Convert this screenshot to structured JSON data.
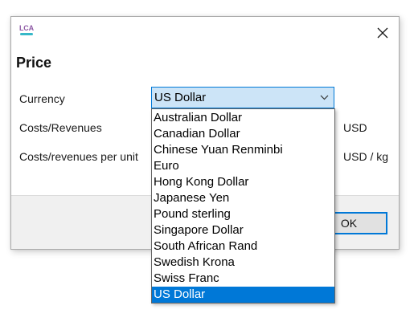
{
  "dialog": {
    "title": "Price",
    "app_icon": {
      "name": "lca-app-icon",
      "text": "LCA"
    },
    "close_icon": "close-icon"
  },
  "form": {
    "currency_label": "Currency",
    "costs_label": "Costs/Revenues",
    "costs_per_unit_label": "Costs/revenues per unit",
    "costs_unit": "USD",
    "costs_per_unit_unit": "USD / kg"
  },
  "currency_select": {
    "value": "US Dollar",
    "arrow_icon": "chevron-down-icon",
    "options": [
      "Australian Dollar",
      "Canadian Dollar",
      "Chinese Yuan Renminbi",
      "Euro",
      "Hong Kong Dollar",
      "Japanese Yen",
      "Pound sterling",
      "Singapore Dollar",
      "South African Rand",
      "Swedish Krona",
      "Swiss Franc",
      "US Dollar"
    ],
    "selected_index": 11
  },
  "footer": {
    "ok_label": "OK"
  },
  "colors": {
    "accent": "#0078d7",
    "combo_background": "#cce4f7",
    "footer_background": "#f0f0f0",
    "icon_purple": "#8e5aa5",
    "icon_teal": "#36b8c8"
  }
}
